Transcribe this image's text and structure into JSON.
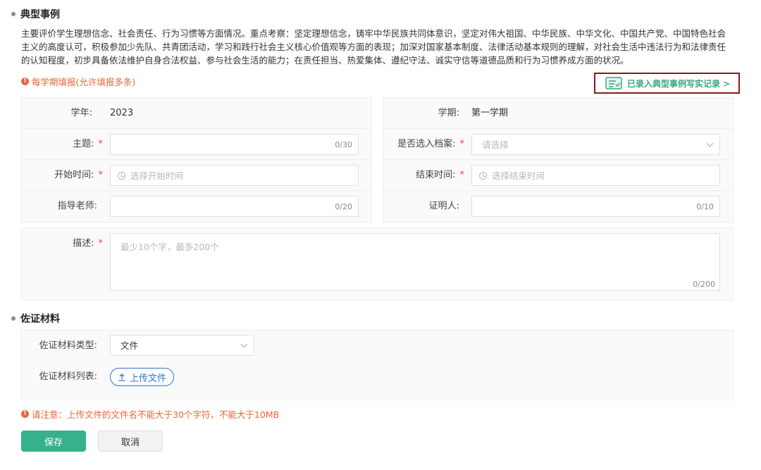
{
  "section1": {
    "title": "典型事例"
  },
  "description": "主要评价学生理想信念、社会责任、行为习惯等方面情况。重点考察：坚定理想信念，铸牢中华民族共同体意识，坚定对伟大祖国、中华民族、中华文化、中国共产党、中国特色社会主义的高度认可，积极参加少先队、共青团活动，学习和践行社会主义核心价值观等方面的表现；加深对国家基本制度、法律活动基本规则的理解，对社会生活中违法行为和法律责任的认知程度，初步具备依法维护自身合法权益、参与社会生活的能力；在责任担当、热爱集体、遵纪守法、诚实守信等道德品质和行为习惯养成方面的状况。",
  "note_top": "每学期填报(允许填报多条)",
  "record_link": "已录入典型事例写实记录 >",
  "form": {
    "year_label": "学年:",
    "year_value": "2023",
    "term_label": "学期:",
    "term_value": "第一学期",
    "topic_label": "主题:",
    "topic_counter": "0/30",
    "archive_label": "是否选入档案:",
    "archive_placeholder": "请选择",
    "start_label": "开始时间:",
    "start_placeholder": "选择开始时间",
    "end_label": "结束时间:",
    "end_placeholder": "选择结束时间",
    "teacher_label": "指导老师:",
    "teacher_counter": "0/20",
    "witness_label": "证明人:",
    "witness_counter": "0/10",
    "desc_label": "描述:",
    "desc_placeholder": "最少10个字，最多200个",
    "desc_counter": "0/200",
    "required_mark": "*"
  },
  "section2": {
    "title": "佐证材料"
  },
  "evidence": {
    "type_label": "佐证材料类型:",
    "type_value": "文件",
    "list_label": "佐证材料列表:",
    "upload_label": "上传文件"
  },
  "note_bottom": "请注意：上传文件的文件名不能大于30个字符，不能大于10MB",
  "buttons": {
    "save": "保存",
    "cancel": "取消"
  },
  "colors": {
    "accent": "#36b18b",
    "warning": "#e8663c",
    "link_blue": "#2f74d0",
    "required": "#e5484d"
  }
}
